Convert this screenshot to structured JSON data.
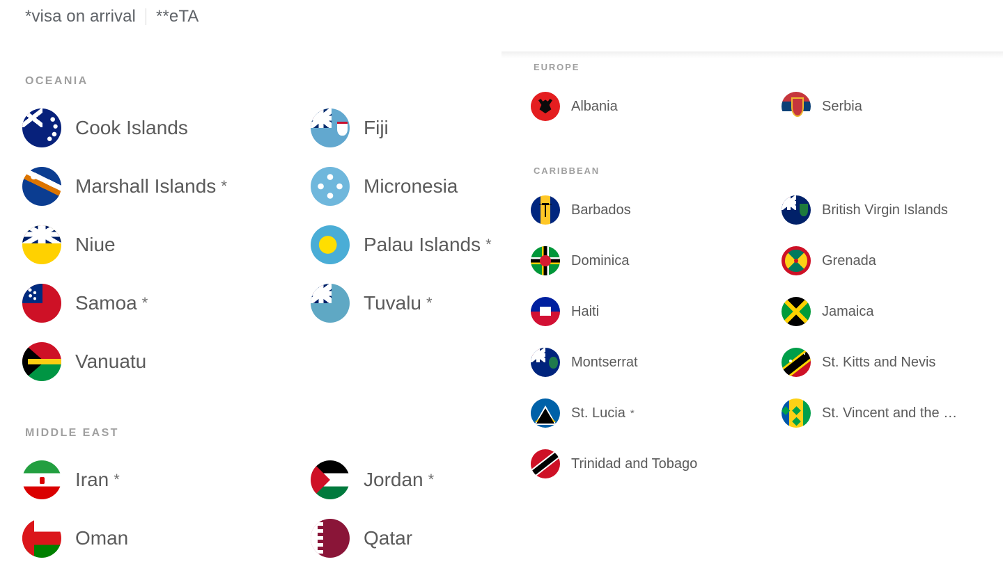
{
  "legend": {
    "visa_on_arrival": "*visa on arrival",
    "eta": "**eTA"
  },
  "left_panel": {
    "sections": [
      {
        "id": "oceania",
        "title": "OCEANIA",
        "countries": [
          {
            "name": "Cook Islands",
            "note": "",
            "flag": "cook-islands"
          },
          {
            "name": "Fiji",
            "note": "",
            "flag": "fiji"
          },
          {
            "name": "Marshall Islands",
            "note": "*",
            "flag": "marshall-islands"
          },
          {
            "name": "Micronesia",
            "note": "",
            "flag": "micronesia"
          },
          {
            "name": "Niue",
            "note": "",
            "flag": "niue"
          },
          {
            "name": "Palau Islands",
            "note": "*",
            "flag": "palau"
          },
          {
            "name": "Samoa",
            "note": "*",
            "flag": "samoa"
          },
          {
            "name": "Tuvalu",
            "note": "*",
            "flag": "tuvalu"
          },
          {
            "name": "Vanuatu",
            "note": "",
            "flag": "vanuatu"
          }
        ]
      },
      {
        "id": "middle-east",
        "title": "MIDDLE EAST",
        "countries": [
          {
            "name": "Iran",
            "note": "*",
            "flag": "iran"
          },
          {
            "name": "Jordan",
            "note": "*",
            "flag": "jordan"
          },
          {
            "name": "Oman",
            "note": "",
            "flag": "oman"
          },
          {
            "name": "Qatar",
            "note": "",
            "flag": "qatar"
          }
        ]
      }
    ]
  },
  "right_panel": {
    "sections": [
      {
        "id": "europe",
        "title": "EUROPE",
        "countries": [
          {
            "name": "Albania",
            "note": "",
            "flag": "albania"
          },
          {
            "name": "Serbia",
            "note": "",
            "flag": "serbia"
          }
        ]
      },
      {
        "id": "caribbean",
        "title": "CARIBBEAN",
        "countries": [
          {
            "name": "Barbados",
            "note": "",
            "flag": "barbados"
          },
          {
            "name": "British Virgin Islands",
            "note": "",
            "flag": "bvi"
          },
          {
            "name": "Dominica",
            "note": "",
            "flag": "dominica"
          },
          {
            "name": "Grenada",
            "note": "",
            "flag": "grenada"
          },
          {
            "name": "Haiti",
            "note": "",
            "flag": "haiti"
          },
          {
            "name": "Jamaica",
            "note": "",
            "flag": "jamaica"
          },
          {
            "name": "Montserrat",
            "note": "",
            "flag": "montserrat"
          },
          {
            "name": "St. Kitts and Nevis",
            "note": "",
            "flag": "st-kitts-nevis"
          },
          {
            "name": "St. Lucia",
            "note": "*",
            "flag": "st-lucia"
          },
          {
            "name": "St. Vincent and the …",
            "note": "",
            "flag": "st-vincent"
          },
          {
            "name": "Trinidad and Tobago",
            "note": "",
            "flag": "trinidad-tobago"
          }
        ]
      }
    ]
  },
  "colors": {
    "text": "#5b5b5b",
    "section_header": "#a0a0a0",
    "background": "#ffffff"
  }
}
